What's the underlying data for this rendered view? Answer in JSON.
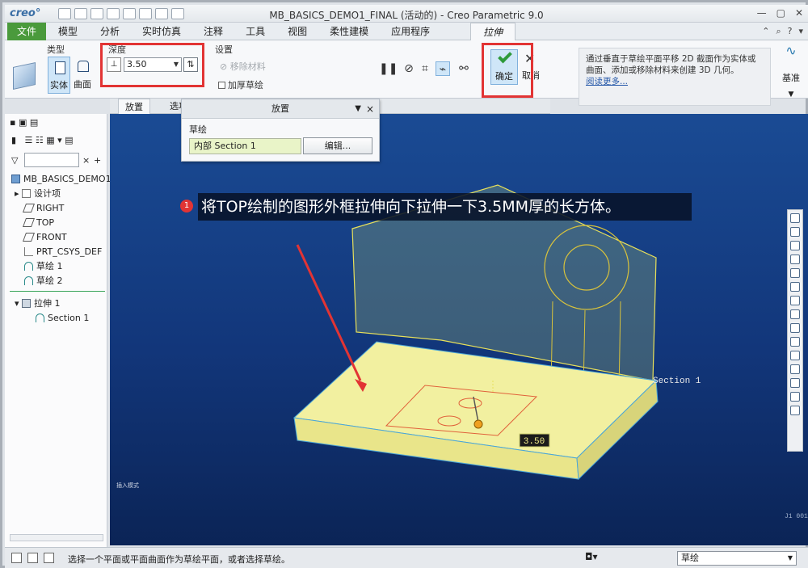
{
  "window": {
    "logo": "creo°",
    "title": "MB_BASICS_DEMO1_FINAL (活动的) - Creo Parametric 9.0",
    "controls": [
      "—",
      "▢",
      "✕"
    ]
  },
  "ribbon_tabs": {
    "file": "文件",
    "items": [
      "模型",
      "分析",
      "实时仿真",
      "注释",
      "工具",
      "视图",
      "柔性建模",
      "应用程序"
    ],
    "active": "拉伸"
  },
  "ribbon": {
    "type_label": "类型",
    "solid": "实体",
    "surface": "曲面",
    "depth_label": "深度",
    "depth_value": "3.50",
    "settings_label": "设置",
    "remove_material": "移除材料",
    "thicken_sketch": "加厚草绘",
    "ok": "确定",
    "cancel": "取消",
    "tip_text": "通过垂直于草绘平面平移 2D 截面作为实体或曲面、添加或移除材料来创建 3D 几何。",
    "tip_link": "阅读更多...",
    "datum": "基准"
  },
  "sub_tabs": [
    "放置",
    "选项"
  ],
  "placement_panel": {
    "title": "放置",
    "sketch_label": "草绘",
    "section_value": "内部 Section 1",
    "edit_button": "编辑..."
  },
  "model_tree": {
    "root": "MB_BASICS_DEMO1_",
    "items": [
      {
        "label": "设计项",
        "icon": "design-items-icon"
      },
      {
        "label": "RIGHT",
        "icon": "datum-plane-icon"
      },
      {
        "label": "TOP",
        "icon": "datum-plane-icon"
      },
      {
        "label": "FRONT",
        "icon": "datum-plane-icon"
      },
      {
        "label": "PRT_CSYS_DEF",
        "icon": "csys-icon"
      },
      {
        "label": "草绘 1",
        "icon": "sketch-icon"
      },
      {
        "label": "草绘 2",
        "icon": "sketch-icon"
      }
    ],
    "extrude": "拉伸 1",
    "section": "Section 1"
  },
  "viewport": {
    "step_number": "1",
    "instruction": "将TOP绘制的图形外框拉伸向下拉伸一下3.5MM厚的长方体。",
    "dimension_tag": "3.50",
    "section_label": "Section 1",
    "corner_note": "插入模式",
    "triad_text": "J1 001 5"
  },
  "statusbar": {
    "message": "选择一个平面或平面曲面作为草绘平面，或者选择草绘。",
    "filter": "草绘"
  },
  "colors": {
    "file_tab": "#4a9a3c",
    "highlight_red": "#e23434",
    "viewport_top": "#1a4b94",
    "viewport_bottom": "#0b2456",
    "part_yellow": "#f2f0a0"
  }
}
